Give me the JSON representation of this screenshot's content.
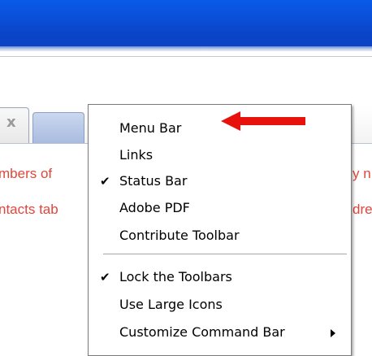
{
  "tabs": {
    "close_glyph": "x"
  },
  "content": {
    "line1_left": "mbers of",
    "line1_right": "y n",
    "line2_left": "ntacts tab",
    "line2_right": "dre"
  },
  "menu": {
    "items": [
      {
        "label": "Menu Bar",
        "checked": false,
        "has_submenu": false
      },
      {
        "label": "Links",
        "checked": false,
        "has_submenu": false
      },
      {
        "label": "Status Bar",
        "checked": true,
        "has_submenu": false
      },
      {
        "label": "Adobe PDF",
        "checked": false,
        "has_submenu": false
      },
      {
        "label": "Contribute Toolbar",
        "checked": false,
        "has_submenu": false
      },
      {
        "label": "Lock the Toolbars",
        "checked": true,
        "has_submenu": false
      },
      {
        "label": "Use Large Icons",
        "checked": false,
        "has_submenu": false
      },
      {
        "label": "Customize Command Bar",
        "checked": false,
        "has_submenu": true
      }
    ],
    "check_glyph": "✔"
  },
  "colors": {
    "titlebar": "#0a4fd8",
    "content_text": "#e0463b",
    "annotation_arrow": "#e8120c"
  },
  "icons": {
    "annotation": "red-arrow-icon",
    "check": "check-icon",
    "submenu": "submenu-arrow-icon"
  }
}
